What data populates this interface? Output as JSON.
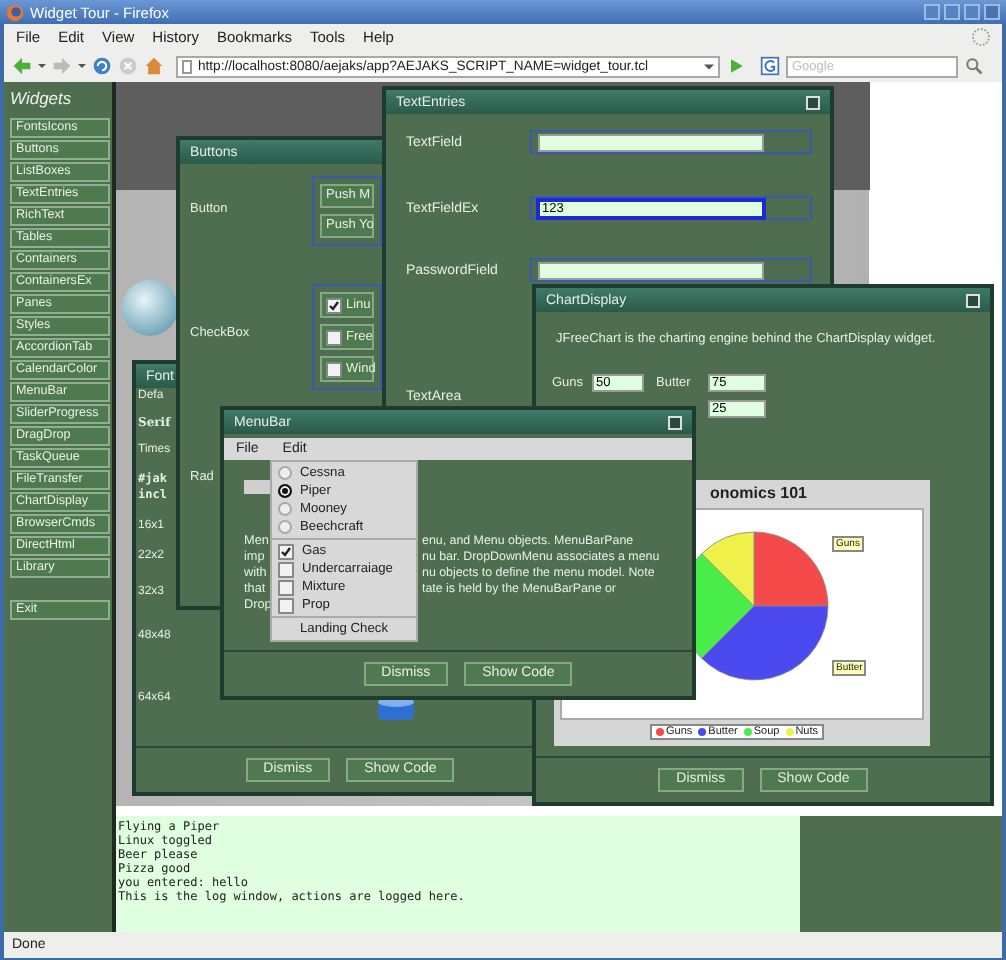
{
  "browser": {
    "title": "Widget Tour - Firefox",
    "menu": [
      "File",
      "Edit",
      "View",
      "History",
      "Bookmarks",
      "Tools",
      "Help"
    ],
    "url": "http://localhost:8080/aejaks/app?AEJAKS_SCRIPT_NAME=widget_tour.tcl",
    "search_placeholder": "Google"
  },
  "sidebar": {
    "title": "Widgets",
    "items": [
      "FontsIcons",
      "Buttons",
      "ListBoxes",
      "TextEntries",
      "RichText",
      "Tables",
      "Containers",
      "ContainersEx",
      "Panes",
      "Styles",
      "AccordionTab",
      "CalendarColor",
      "MenuBar",
      "SliderProgress",
      "DragDrop",
      "TaskQueue",
      "FileTransfer",
      "ChartDisplay",
      "BrowserCmds",
      "DirectHtml",
      "Library"
    ],
    "exit": "Exit"
  },
  "fonts_window": {
    "title": "Font",
    "lines": [
      {
        "text": "Defa",
        "kind": "plain"
      },
      {
        "text": "Serif",
        "kind": "bold"
      },
      {
        "text": "Times",
        "kind": "plain"
      },
      {
        "text": "#jak",
        "kind": "mono"
      },
      {
        "text": "incl",
        "kind": "mono"
      },
      {
        "text": "16x1",
        "kind": "plain"
      },
      {
        "text": "22x2",
        "kind": "plain"
      },
      {
        "text": "32x3",
        "kind": "plain"
      },
      {
        "text": "48x48",
        "kind": "plain"
      },
      {
        "text": "64x64",
        "kind": "plain"
      }
    ],
    "buttons": [
      "Dismiss",
      "Show Code"
    ]
  },
  "buttons_window": {
    "title": "Buttons",
    "labels": [
      "Button",
      "CheckBox",
      "Rad"
    ],
    "push_buttons": [
      "Push M",
      "Push Yo"
    ],
    "checkboxes": [
      {
        "label": "Linu",
        "checked": true
      },
      {
        "label": "Free",
        "checked": false
      },
      {
        "label": "Wind",
        "checked": false
      }
    ]
  },
  "text_entries_window": {
    "title": "TextEntries",
    "fields": [
      {
        "label": "TextField",
        "focused": false
      },
      {
        "label": "TextFieldEx",
        "value": "123",
        "focused": true
      },
      {
        "label": "PasswordField",
        "focused": false
      },
      {
        "label": "TextArea"
      }
    ]
  },
  "chart_window": {
    "title": "ChartDisplay",
    "description": "JFreeChart is the charting engine behind the ChartDisplay widget.",
    "inputs": [
      {
        "label": "Guns",
        "value": "50"
      },
      {
        "label": "Butter",
        "value": "75"
      },
      {
        "value": "25"
      }
    ],
    "chart_data": {
      "type": "pie",
      "title": "onomics 101",
      "categories": [
        "Guns",
        "Butter",
        "Soup",
        "Nuts"
      ],
      "colors": [
        "#f44a4a",
        "#4a4af0",
        "#4aee4a",
        "#f0f04a"
      ],
      "legend": "bottom",
      "series": [
        {
          "values": [
            25,
            37.5,
            25,
            12.5
          ]
        }
      ]
    },
    "callouts": [
      "Guns",
      "Butter"
    ],
    "buttons": [
      "Dismiss",
      "Show Code"
    ]
  },
  "menubar_window": {
    "title": "MenuBar",
    "menus": [
      "File",
      "Edit"
    ],
    "dropdown": [
      {
        "kind": "radio",
        "label": "Cessna",
        "selected": false
      },
      {
        "kind": "radio",
        "label": "Piper",
        "selected": true
      },
      {
        "kind": "radio",
        "label": "Mooney",
        "selected": false
      },
      {
        "kind": "radio",
        "label": "Beechcraft",
        "selected": false
      },
      {
        "kind": "separator"
      },
      {
        "kind": "check",
        "label": "Gas",
        "checked": true
      },
      {
        "kind": "check",
        "label": "Undercarraiage",
        "checked": false
      },
      {
        "kind": "check",
        "label": "Mixture",
        "checked": false
      },
      {
        "kind": "check",
        "label": "Prop",
        "checked": false
      },
      {
        "kind": "separator"
      },
      {
        "kind": "command",
        "label": "Landing Check"
      }
    ],
    "text_left": [
      "Men",
      "imp",
      "with",
      "that",
      "Drop"
    ],
    "text_right": [
      "enu, and Menu objects. MenuBarPane",
      "nu bar. DropDownMenu associates a menu",
      "nu objects to define the menu model. Note",
      "tate is held by the MenuBarPane or"
    ],
    "buttons": [
      "Dismiss",
      "Show Code"
    ]
  },
  "log": [
    "Flying a Piper",
    "Linux toggled",
    "Beer please",
    "Pizza good",
    "you entered: hello",
    "This is the log window, actions are logged here."
  ],
  "status": "Done"
}
